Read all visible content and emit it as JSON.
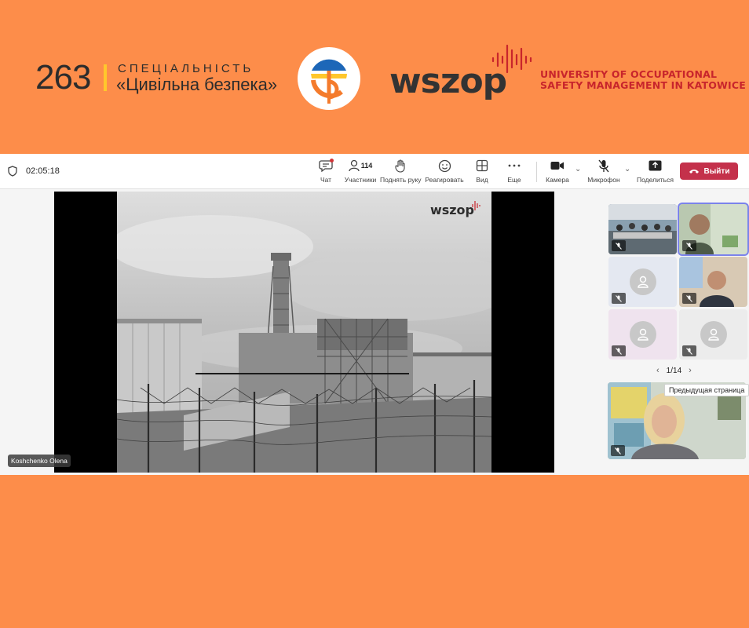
{
  "banner": {
    "number": "263",
    "specialty_label": "СПЕЦІАЛЬНІСТЬ",
    "specialty_name": "«Цивільна безпека»",
    "logo_text": "wszop",
    "university_line1": "UNIVERSITY OF OCCUPATIONAL",
    "university_line2": "SAFETY MANAGEMENT IN KATOWICE",
    "colors": {
      "background": "#fd8d4a",
      "accent_red": "#c8252c",
      "accent_yellow": "#ffc72c",
      "accent_blue": "#1d67b8"
    }
  },
  "meeting": {
    "timer": "02:05:18",
    "toolbar": {
      "chat": {
        "label": "Чат",
        "icon": "chat-icon"
      },
      "participants": {
        "label": "Участники",
        "count": "114",
        "icon": "people-icon"
      },
      "raise_hand": {
        "label": "Поднять руку",
        "icon": "hand-icon"
      },
      "react": {
        "label": "Реагировать",
        "icon": "smiley-icon"
      },
      "view": {
        "label": "Вид",
        "icon": "grid-icon"
      },
      "more": {
        "label": "Еще",
        "icon": "ellipsis-icon"
      },
      "camera": {
        "label": "Камера",
        "icon": "camera-icon"
      },
      "mic": {
        "label": "Микрофон",
        "icon": "mic-off-icon"
      },
      "share": {
        "label": "Поделиться",
        "icon": "share-icon"
      },
      "leave": {
        "label": "Выйти",
        "icon": "phone-hangup-icon"
      }
    },
    "stage": {
      "slide_logo": "wszop",
      "presenter_name": "Koshchenko Olena"
    },
    "gallery": {
      "page_indicator": "1/14",
      "tooltip": "Предыдущая страница"
    },
    "colors": {
      "leave_button": "#c4314b",
      "speaking_outline": "#7b83eb"
    }
  }
}
